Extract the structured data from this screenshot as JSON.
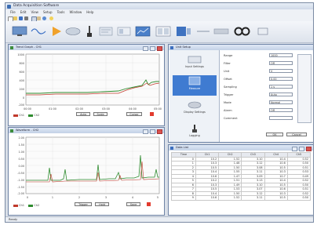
{
  "app": {
    "title": "Data Acquisition Software",
    "menu": [
      "File",
      "Edit",
      "View",
      "Setup",
      "Tools",
      "Window",
      "Help"
    ]
  },
  "toolbar_icons": [
    "new-icon",
    "open-icon",
    "save-icon",
    "print-icon",
    "copy-icon",
    "paste-icon",
    "undo-icon",
    "help-icon"
  ],
  "big_toolbar": [
    "monitor-icon",
    "scope-icon",
    "play-icon",
    "stop-icon",
    "probe-icon",
    "settings-icon",
    "report-icon",
    "graph-icon",
    "table-icon",
    "export-icon",
    "link-icon",
    "more-icon"
  ],
  "trend_window": {
    "title": "Trend Graph - CH1",
    "y_ticks": [
      "1000",
      "800",
      "600",
      "400",
      "200",
      "0",
      "-200"
    ],
    "x_ticks": [
      "00:00",
      "01:00",
      "02:00",
      "03:00",
      "04:00",
      "05:00"
    ],
    "legend": [
      "Ch1",
      "Ch2"
    ],
    "buttons": [
      "Auto",
      "Scale",
      "Cursor"
    ],
    "colors": {
      "ch1": "#c0392b",
      "ch2": "#2e8b2e"
    }
  },
  "wave_window": {
    "title": "Waveform - CH2",
    "y_ticks": [
      "2.00",
      "1.50",
      "1.00",
      "0.50",
      "0.00",
      "-0.50",
      "-1.00",
      "-1.50",
      "-2.00"
    ],
    "x_ticks": [
      "0",
      "1",
      "2",
      "3",
      "4",
      "5"
    ],
    "legend": [
      "Ch1",
      "Ch2"
    ],
    "buttons": [
      "Trigger",
      "Hold",
      "Save"
    ],
    "colors": {
      "ch1": "#c0392b",
      "ch2": "#2e8b2e"
    }
  },
  "setup_window": {
    "title": "Unit Setup",
    "sidebar": [
      "Input Settings",
      "Measure",
      "Display Settings",
      "Logging"
    ],
    "fields": [
      {
        "label": "Range",
        "value": "1000"
      },
      {
        "label": "Filter",
        "value": "Off"
      },
      {
        "label": "Unit",
        "value": "V"
      },
      {
        "label": "Offset",
        "value": "0.00"
      },
      {
        "label": "Sampling",
        "value": "1 s"
      },
      {
        "label": "Trigger",
        "value": "Auto"
      },
      {
        "label": "Mode",
        "value": "Normal"
      },
      {
        "label": "Alarm",
        "value": "Off"
      },
      {
        "label": "Comment",
        "value": ""
      }
    ],
    "buttons": [
      "OK",
      "Cancel"
    ]
  },
  "data_window": {
    "title": "Data List",
    "columns": [
      "Time",
      "Ch1",
      "Ch2",
      "Ch3",
      "Ch4",
      "Ch5"
    ],
    "rows": [
      [
        "0",
        "10.2",
        "1.52",
        "3.10",
        "10.4",
        "0.52"
      ],
      [
        "1",
        "10.3",
        "1.48",
        "3.12",
        "10.6",
        "0.50"
      ],
      [
        "2",
        "10.5",
        "1.50",
        "3.08",
        "10.5",
        "0.51"
      ],
      [
        "3",
        "10.4",
        "1.55",
        "3.11",
        "10.3",
        "0.53"
      ],
      [
        "4",
        "10.6",
        "1.47",
        "3.09",
        "10.7",
        "0.49"
      ],
      [
        "5",
        "10.2",
        "1.51",
        "3.13",
        "10.4",
        "0.52"
      ],
      [
        "6",
        "10.3",
        "1.49",
        "3.10",
        "10.5",
        "0.50"
      ],
      [
        "7",
        "10.5",
        "1.53",
        "3.07",
        "10.6",
        "0.51"
      ],
      [
        "8",
        "10.4",
        "1.50",
        "3.12",
        "10.3",
        "0.52"
      ],
      [
        "9",
        "10.6",
        "1.52",
        "3.11",
        "10.5",
        "0.50"
      ]
    ]
  },
  "status": "Ready"
}
